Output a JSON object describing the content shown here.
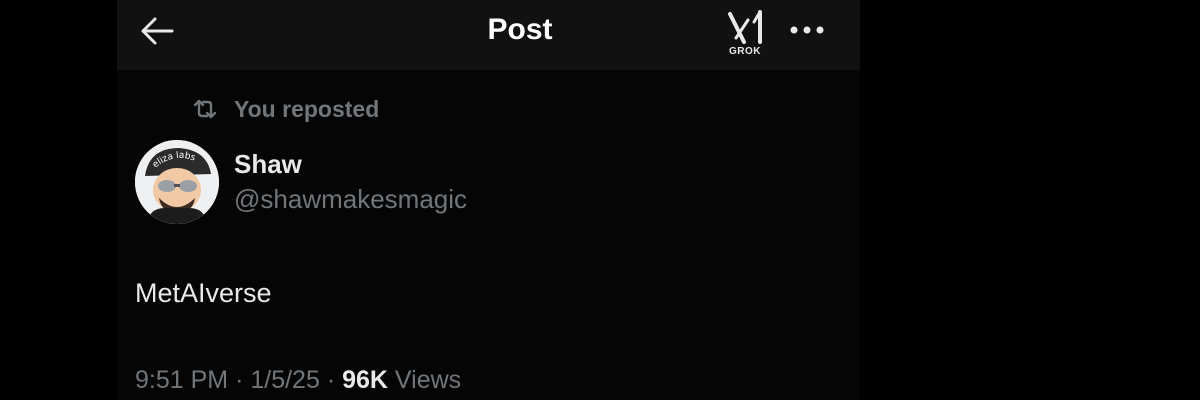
{
  "header": {
    "title": "Post",
    "grok_label": "GROK",
    "back_icon": "arrow-left-icon",
    "more_icon": "ellipsis-horizontal-icon"
  },
  "post": {
    "repost_text": "You reposted",
    "repost_icon": "repost-icon",
    "author": {
      "name": "Shaw",
      "handle": "@shawmakesmagic",
      "avatar_caption": "eliza labs"
    },
    "text": "MetAIverse",
    "time": "9:51 PM",
    "date": "1/5/25",
    "separator": "·",
    "views_count": "96K",
    "views_label": "Views"
  },
  "colors": {
    "background": "#000000",
    "header_bg": "#111111",
    "primary_text": "#e7e9ea",
    "secondary_text": "#71767b"
  }
}
